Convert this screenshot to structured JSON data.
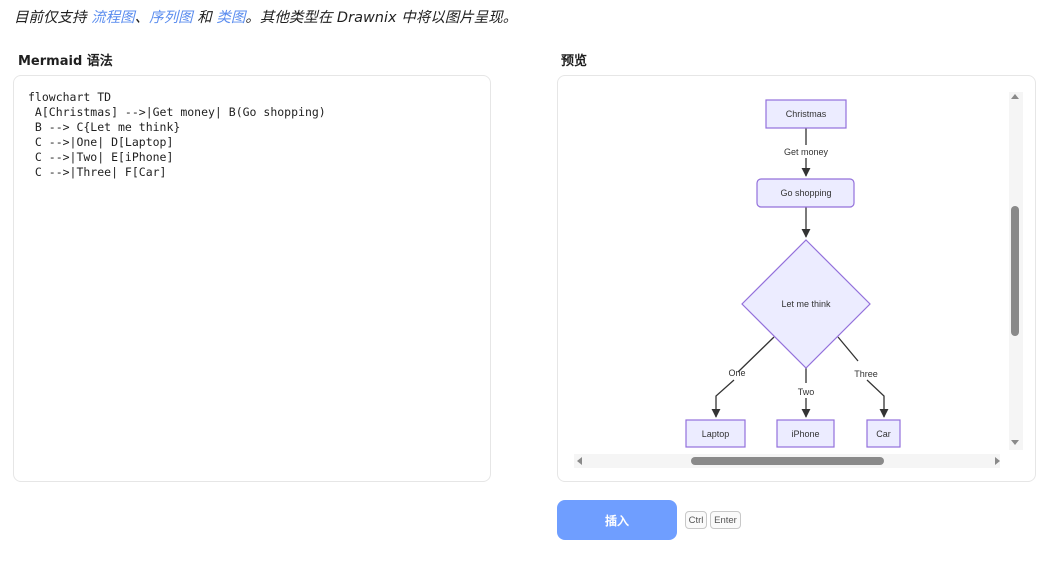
{
  "intro": {
    "prefix": "目前仅支持 ",
    "link1": "流程图",
    "sep1": "、",
    "link2": "序列图",
    "sep2": " 和 ",
    "link3": "类图",
    "suffix": "。其他类型在 Drawnix 中将以图片呈现。"
  },
  "editor": {
    "label": "Mermaid 语法",
    "code": "flowchart TD\n A[Christmas] -->|Get money| B(Go shopping)\n B --> C{Let me think}\n C -->|One| D[Laptop]\n C -->|Two| E[iPhone]\n C -->|Three| F[Car]"
  },
  "preview": {
    "label": "预览",
    "diagram": {
      "nodes": {
        "christmas": "Christmas",
        "go_shopping": "Go shopping",
        "let_me_think": "Let me think",
        "laptop": "Laptop",
        "iphone": "iPhone",
        "car": "Car"
      },
      "edges": {
        "get_money": "Get money",
        "one": "One",
        "two": "Two",
        "three": "Three"
      },
      "colors": {
        "fill": "#ECECFF",
        "stroke": "#9370DB",
        "line": "#333333"
      }
    }
  },
  "actions": {
    "insert_label": "插入",
    "shortcut_ctrl": "Ctrl",
    "shortcut_enter": "Enter",
    "insert_color": "#6f9eff"
  }
}
